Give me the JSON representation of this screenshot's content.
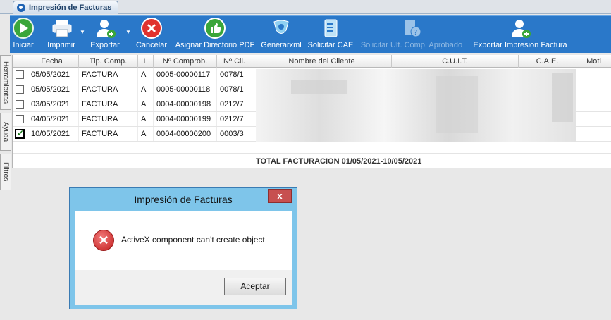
{
  "tab": {
    "title": "Impresión de Facturas"
  },
  "toolbar": {
    "buttons": [
      {
        "label": "Iniciar",
        "icon": "play-icon"
      },
      {
        "label": "Imprimir",
        "icon": "printer-icon"
      },
      {
        "label": "Exportar",
        "icon": "export-user-icon"
      },
      {
        "label": "Cancelar",
        "icon": "cancel-icon"
      },
      {
        "label": "Asignar Directorio PDF",
        "icon": "thumbs-up-icon"
      },
      {
        "label": "Generarxml",
        "icon": "xml-icon"
      },
      {
        "label": "Solicitar CAE",
        "icon": "checklist-icon"
      },
      {
        "label": "Solicitar Ult. Comp. Aprobado",
        "icon": "document-question-icon"
      },
      {
        "label": "Exportar Impresion Factura",
        "icon": "export-user-icon"
      }
    ]
  },
  "sidetabs": {
    "herramientas": "Herramientas",
    "ayuda": "Ayuda",
    "filtros": "Filtros"
  },
  "grid": {
    "columns": [
      "",
      "Fecha",
      "Tip. Comp.",
      "L",
      "Nº Comprob.",
      "Nº Cli.",
      "Nombre del Cliente",
      "C.U.I.T.",
      "C.A.E.",
      "Moti"
    ],
    "rows": [
      {
        "checked": false,
        "fecha": "05/05/2021",
        "tipo": "FACTURA",
        "letra": "A",
        "comprob": "0005-00000117",
        "cliente": "0078/1"
      },
      {
        "checked": false,
        "fecha": "05/05/2021",
        "tipo": "FACTURA",
        "letra": "A",
        "comprob": "0005-00000118",
        "cliente": "0078/1"
      },
      {
        "checked": false,
        "fecha": "03/05/2021",
        "tipo": "FACTURA",
        "letra": "A",
        "comprob": "0004-00000198",
        "cliente": "0212/7"
      },
      {
        "checked": false,
        "fecha": "04/05/2021",
        "tipo": "FACTURA",
        "letra": "A",
        "comprob": "0004-00000199",
        "cliente": "0212/7"
      },
      {
        "checked": true,
        "fecha": "10/05/2021",
        "tipo": "FACTURA",
        "letra": "A",
        "comprob": "0004-00000200",
        "cliente": "0003/3"
      }
    ],
    "total": "TOTAL FACTURACION 01/05/2021-10/05/2021"
  },
  "dialog": {
    "title": "Impresión de Facturas",
    "close": "x",
    "message": "ActiveX component can't create object",
    "ok": "Aceptar"
  },
  "colors": {
    "toolbar": "#2a78c9",
    "accent": "#1f63b3",
    "error": "#c21d1d"
  }
}
